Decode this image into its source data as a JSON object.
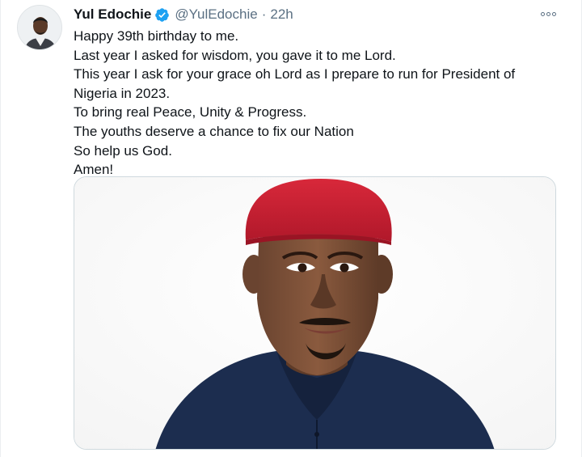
{
  "tweet": {
    "author": {
      "display_name": "Yul Edochie",
      "handle": "@YulEdochie",
      "verified": true,
      "avatar_icon": "profile-photo"
    },
    "separator": "·",
    "timestamp": "22h",
    "more_icon": "more-options-icon",
    "lines": [
      "Happy 39th birthday to me.",
      "Last year I asked for wisdom, you gave it to me Lord.",
      "This year I ask for your grace oh Lord as I prepare to run for President of",
      "Nigeria in 2023.",
      "To bring real Peace, Unity & Progress.",
      "The youths deserve a chance to fix our Nation",
      "So help us God.",
      "Amen!"
    ],
    "media": {
      "type": "photo",
      "description_icon": "portrait-photo"
    },
    "colors": {
      "verified_badge": "#1da1f2",
      "secondary_text": "#5b7083",
      "cap_red": "#c8202f",
      "shirt_navy": "#1c2d4f"
    }
  }
}
